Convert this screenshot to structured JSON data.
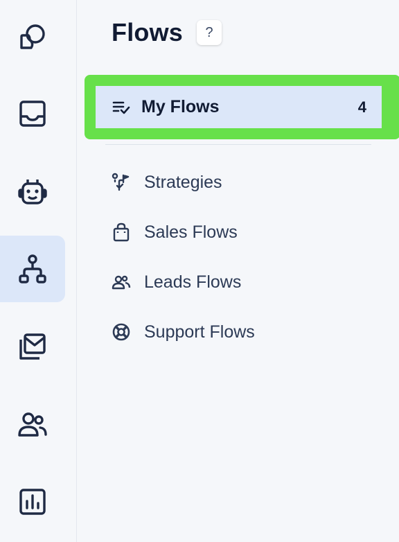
{
  "rail": {
    "items": [
      {
        "icon": "shapes-icon",
        "active": false
      },
      {
        "icon": "inbox-icon",
        "active": false
      },
      {
        "icon": "robot-icon",
        "active": false
      },
      {
        "icon": "flows-icon",
        "active": true
      },
      {
        "icon": "mail-stack-icon",
        "active": false
      },
      {
        "icon": "contacts-icon",
        "active": false
      },
      {
        "icon": "reports-icon",
        "active": false
      }
    ]
  },
  "panel": {
    "title": "Flows",
    "help_label": "?",
    "my_flows": {
      "label": "My Flows",
      "count": "4",
      "icon": "list-check-icon",
      "highlight_color": "#67e04a"
    },
    "items": [
      {
        "label": "Strategies",
        "icon": "strategy-icon"
      },
      {
        "label": "Sales Flows",
        "icon": "shopping-bag-icon"
      },
      {
        "label": "Leads Flows",
        "icon": "users-icon"
      },
      {
        "label": "Support Flows",
        "icon": "lifebuoy-icon"
      }
    ]
  },
  "colors": {
    "active_bg": "#dce7f9",
    "icon": "#1f2a44",
    "highlight": "#67e04a"
  }
}
